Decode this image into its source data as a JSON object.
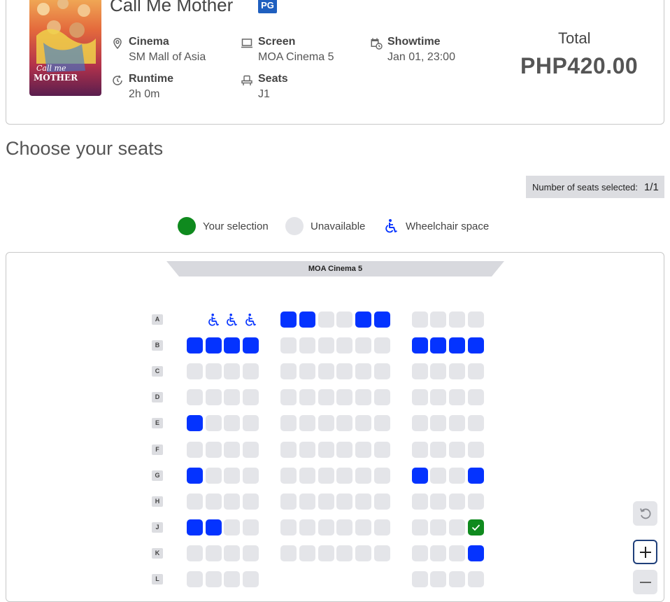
{
  "movie": {
    "title": "Call Me Mother",
    "rating": "PG",
    "poster_title_line1": "Call me",
    "poster_title_line2": "MOTHER"
  },
  "details": {
    "cinema": {
      "label": "Cinema",
      "value": "SM Mall of Asia",
      "icon": "location-pin-icon"
    },
    "screen": {
      "label": "Screen",
      "value": "MOA Cinema 5",
      "icon": "monitor-icon"
    },
    "showtime": {
      "label": "Showtime",
      "value": "Jan 01, 23:00",
      "icon": "calendar-clock-icon"
    },
    "runtime": {
      "label": "Runtime",
      "value": "2h 0m",
      "icon": "clock-icon"
    },
    "seats": {
      "label": "Seats",
      "value": "J1",
      "icon": "seat-icon"
    }
  },
  "total": {
    "label": "Total",
    "value": "PHP420.00"
  },
  "heading": "Choose your seats",
  "selection_count": {
    "label": "Number of seats selected:",
    "value": "1/1"
  },
  "legend": [
    {
      "label": "Your selection",
      "color": "#0f8a1e"
    },
    {
      "label": "Unavailable",
      "color": "#e4e5e9"
    },
    {
      "label": "Wheelchair space",
      "icon": "wheelchair-icon"
    }
  ],
  "screen_name": "MOA Cinema 5",
  "colors": {
    "available": "#0433ff",
    "unavailable": "#e4e5e9",
    "selected": "#0f8a1e",
    "rating_badge": "#1f5fbf"
  },
  "seat_rows": [
    {
      "label": "A",
      "left": [
        "empty",
        "wheelchair",
        "wheelchair",
        "wheelchair"
      ],
      "middle": [
        "available",
        "available",
        "unavailable",
        "unavailable",
        "available",
        "available"
      ],
      "right": [
        "unavailable",
        "unavailable",
        "unavailable",
        "unavailable"
      ]
    },
    {
      "label": "B",
      "left": [
        "available",
        "available",
        "available",
        "available"
      ],
      "middle": [
        "unavailable",
        "unavailable",
        "unavailable",
        "unavailable",
        "unavailable",
        "unavailable"
      ],
      "right": [
        "available",
        "available",
        "available",
        "available"
      ]
    },
    {
      "label": "C",
      "left": [
        "unavailable",
        "unavailable",
        "unavailable",
        "unavailable"
      ],
      "middle": [
        "unavailable",
        "unavailable",
        "unavailable",
        "unavailable",
        "unavailable",
        "unavailable"
      ],
      "right": [
        "unavailable",
        "unavailable",
        "unavailable",
        "unavailable"
      ]
    },
    {
      "label": "D",
      "left": [
        "unavailable",
        "unavailable",
        "unavailable",
        "unavailable"
      ],
      "middle": [
        "unavailable",
        "unavailable",
        "unavailable",
        "unavailable",
        "unavailable",
        "unavailable"
      ],
      "right": [
        "unavailable",
        "unavailable",
        "unavailable",
        "unavailable"
      ]
    },
    {
      "label": "E",
      "left": [
        "available",
        "unavailable",
        "unavailable",
        "unavailable"
      ],
      "middle": [
        "unavailable",
        "unavailable",
        "unavailable",
        "unavailable",
        "unavailable",
        "unavailable"
      ],
      "right": [
        "unavailable",
        "unavailable",
        "unavailable",
        "unavailable"
      ]
    },
    {
      "label": "F",
      "left": [
        "unavailable",
        "unavailable",
        "unavailable",
        "unavailable"
      ],
      "middle": [
        "unavailable",
        "unavailable",
        "unavailable",
        "unavailable",
        "unavailable",
        "unavailable"
      ],
      "right": [
        "unavailable",
        "unavailable",
        "unavailable",
        "unavailable"
      ]
    },
    {
      "label": "G",
      "left": [
        "available",
        "unavailable",
        "unavailable",
        "unavailable"
      ],
      "middle": [
        "unavailable",
        "unavailable",
        "unavailable",
        "unavailable",
        "unavailable",
        "unavailable"
      ],
      "right": [
        "available",
        "unavailable",
        "unavailable",
        "available"
      ]
    },
    {
      "label": "H",
      "left": [
        "unavailable",
        "unavailable",
        "unavailable",
        "unavailable"
      ],
      "middle": [
        "unavailable",
        "unavailable",
        "unavailable",
        "unavailable",
        "unavailable",
        "unavailable"
      ],
      "right": [
        "unavailable",
        "unavailable",
        "unavailable",
        "unavailable"
      ]
    },
    {
      "label": "J",
      "left": [
        "available",
        "available",
        "unavailable",
        "unavailable"
      ],
      "middle": [
        "unavailable",
        "unavailable",
        "unavailable",
        "unavailable",
        "unavailable",
        "unavailable"
      ],
      "right": [
        "unavailable",
        "unavailable",
        "unavailable",
        "selected"
      ]
    },
    {
      "label": "K",
      "left": [
        "unavailable",
        "unavailable",
        "unavailable",
        "unavailable"
      ],
      "middle": [
        "unavailable",
        "unavailable",
        "unavailable",
        "unavailable",
        "unavailable",
        "unavailable"
      ],
      "right": [
        "unavailable",
        "unavailable",
        "unavailable",
        "available"
      ]
    },
    {
      "label": "L",
      "left": [
        "unavailable",
        "unavailable",
        "unavailable",
        "unavailable"
      ],
      "middle": [],
      "right": [
        "unavailable",
        "unavailable",
        "unavailable",
        "unavailable"
      ]
    }
  ],
  "controls": [
    {
      "name": "reset-zoom-button",
      "icon": "reset-icon"
    },
    {
      "name": "zoom-in-button",
      "icon": "plus-icon"
    },
    {
      "name": "zoom-out-button",
      "icon": "minus-icon"
    }
  ]
}
